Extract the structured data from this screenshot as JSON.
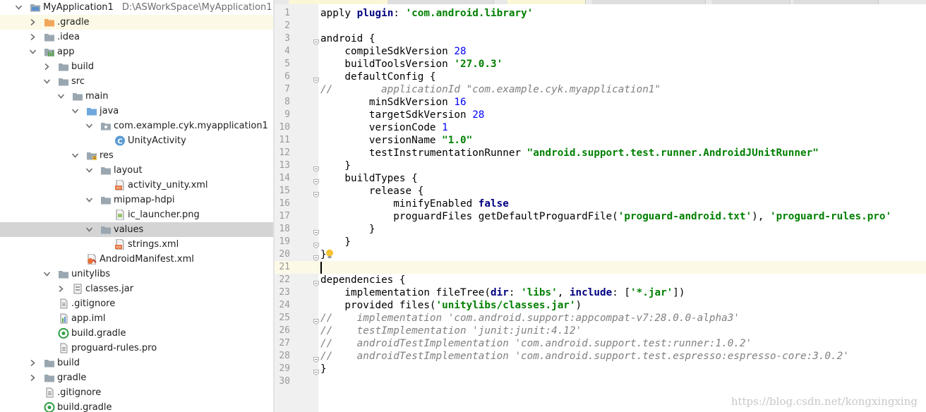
{
  "project_tree": {
    "rows": [
      {
        "label": "MyApplication1",
        "path": "D:\\ASWorkSpace\\MyApplication1",
        "icon": "module-icon",
        "arrow": "down",
        "indent": 0
      },
      {
        "label": ".gradle",
        "icon": "folder-orange-icon",
        "arrow": "right",
        "indent": 1,
        "highlight": true
      },
      {
        "label": ".idea",
        "icon": "folder-icon",
        "arrow": "right",
        "indent": 1
      },
      {
        "label": "app",
        "icon": "android-module-icon",
        "arrow": "down",
        "indent": 1
      },
      {
        "label": "build",
        "icon": "folder-icon",
        "arrow": "right",
        "indent": 2
      },
      {
        "label": "src",
        "icon": "folder-icon",
        "arrow": "down",
        "indent": 2
      },
      {
        "label": "main",
        "icon": "folder-icon",
        "arrow": "down",
        "indent": 3
      },
      {
        "label": "java",
        "icon": "folder-blue-icon",
        "arrow": "down",
        "indent": 4
      },
      {
        "label": "com.example.cyk.myapplication1",
        "icon": "package-icon",
        "arrow": "down",
        "indent": 5
      },
      {
        "label": "UnityActivity",
        "icon": "class-icon",
        "arrow": "none",
        "indent": 6
      },
      {
        "label": "res",
        "icon": "folder-res-icon",
        "arrow": "down",
        "indent": 4
      },
      {
        "label": "layout",
        "icon": "folder-icon",
        "arrow": "down",
        "indent": 5
      },
      {
        "label": "activity_unity.xml",
        "icon": "xml-file-icon",
        "arrow": "none",
        "indent": 6
      },
      {
        "label": "mipmap-hdpi",
        "icon": "folder-icon",
        "arrow": "down",
        "indent": 5
      },
      {
        "label": "ic_launcher.png",
        "icon": "image-file-icon",
        "arrow": "none",
        "indent": 6
      },
      {
        "label": "values",
        "icon": "folder-icon",
        "arrow": "down",
        "indent": 5,
        "selected": true
      },
      {
        "label": "strings.xml",
        "icon": "xml-file-icon",
        "arrow": "none",
        "indent": 6
      },
      {
        "label": "AndroidManifest.xml",
        "icon": "manifest-file-icon",
        "arrow": "none",
        "indent": 4
      },
      {
        "label": "unitylibs",
        "icon": "folder-icon",
        "arrow": "down",
        "indent": 2
      },
      {
        "label": "classes.jar",
        "icon": "jar-icon",
        "arrow": "right",
        "indent": 3
      },
      {
        "label": ".gitignore",
        "icon": "text-file-icon",
        "arrow": "none",
        "indent": 2
      },
      {
        "label": "app.iml",
        "icon": "iml-file-icon",
        "arrow": "none",
        "indent": 2
      },
      {
        "label": "build.gradle",
        "icon": "gradle-file-icon",
        "arrow": "none",
        "indent": 2
      },
      {
        "label": "proguard-rules.pro",
        "icon": "text-file-icon",
        "arrow": "none",
        "indent": 2
      },
      {
        "label": "build",
        "icon": "folder-icon",
        "arrow": "right",
        "indent": 1
      },
      {
        "label": "gradle",
        "icon": "folder-icon",
        "arrow": "right",
        "indent": 1
      },
      {
        "label": ".gitignore",
        "icon": "text-file-icon",
        "arrow": "none",
        "indent": 1
      },
      {
        "label": "build.gradle",
        "icon": "gradle-file-icon",
        "arrow": "none",
        "indent": 1
      }
    ]
  },
  "editor": {
    "lines": [
      {
        "n": "1",
        "fold": false,
        "tokens": [
          [
            "apply ",
            ""
          ],
          [
            "plugin",
            "kw"
          ],
          [
            ": ",
            ""
          ],
          [
            "'com.android.library'",
            "str"
          ]
        ]
      },
      {
        "n": "2",
        "fold": false,
        "tokens": []
      },
      {
        "n": "3",
        "fold": true,
        "tokens": [
          [
            "android {",
            ""
          ]
        ]
      },
      {
        "n": "4",
        "fold": false,
        "tokens": [
          [
            "    compileSdkVersion ",
            ""
          ],
          [
            "28",
            "num"
          ]
        ]
      },
      {
        "n": "5",
        "fold": false,
        "tokens": [
          [
            "    buildToolsVersion ",
            ""
          ],
          [
            "'27.0.3'",
            "str"
          ]
        ]
      },
      {
        "n": "6",
        "fold": true,
        "tokens": [
          [
            "    defaultConfig {",
            ""
          ]
        ]
      },
      {
        "n": "7",
        "fold": false,
        "tokens": [
          [
            "//        applicationId \"com.example.cyk.myapplication1\"",
            "cm"
          ]
        ]
      },
      {
        "n": "8",
        "fold": false,
        "tokens": [
          [
            "        minSdkVersion ",
            ""
          ],
          [
            "16",
            "num"
          ]
        ]
      },
      {
        "n": "9",
        "fold": false,
        "tokens": [
          [
            "        targetSdkVersion ",
            ""
          ],
          [
            "28",
            "num"
          ]
        ]
      },
      {
        "n": "10",
        "fold": false,
        "tokens": [
          [
            "        versionCode ",
            ""
          ],
          [
            "1",
            "num"
          ]
        ]
      },
      {
        "n": "11",
        "fold": false,
        "tokens": [
          [
            "        versionName ",
            ""
          ],
          [
            "\"1.0\"",
            "str"
          ]
        ]
      },
      {
        "n": "12",
        "fold": false,
        "tokens": [
          [
            "        testInstrumentationRunner ",
            ""
          ],
          [
            "\"android.support.test.runner.AndroidJUnitRunner\"",
            "str"
          ]
        ]
      },
      {
        "n": "13",
        "fold": true,
        "tokens": [
          [
            "    }",
            ""
          ]
        ]
      },
      {
        "n": "14",
        "fold": true,
        "tokens": [
          [
            "    buildTypes {",
            ""
          ]
        ]
      },
      {
        "n": "15",
        "fold": true,
        "tokens": [
          [
            "        release {",
            ""
          ]
        ]
      },
      {
        "n": "16",
        "fold": false,
        "tokens": [
          [
            "            minifyEnabled ",
            ""
          ],
          [
            "false",
            "kw"
          ]
        ]
      },
      {
        "n": "17",
        "fold": false,
        "tokens": [
          [
            "            proguardFiles getDefaultProguardFile(",
            ""
          ],
          [
            "'proguard-android.txt'",
            "str"
          ],
          [
            "), ",
            ""
          ],
          [
            "'proguard-rules.pro'",
            "str"
          ]
        ]
      },
      {
        "n": "18",
        "fold": true,
        "tokens": [
          [
            "        }",
            ""
          ]
        ]
      },
      {
        "n": "19",
        "fold": true,
        "tokens": [
          [
            "    }",
            ""
          ]
        ]
      },
      {
        "n": "20",
        "fold": true,
        "bulb": true,
        "tokens": [
          [
            "}",
            ""
          ]
        ]
      },
      {
        "n": "21",
        "fold": false,
        "caret": true,
        "tokens": []
      },
      {
        "n": "22",
        "fold": true,
        "tokens": [
          [
            "dependencies {",
            ""
          ]
        ]
      },
      {
        "n": "23",
        "fold": false,
        "tokens": [
          [
            "    implementation fileTree(",
            ""
          ],
          [
            "dir",
            "kw"
          ],
          [
            ": ",
            ""
          ],
          [
            "'libs'",
            "str"
          ],
          [
            ", ",
            ""
          ],
          [
            "include",
            "kw"
          ],
          [
            ": [",
            ""
          ],
          [
            "'*.jar'",
            "str"
          ],
          [
            "])",
            ""
          ]
        ]
      },
      {
        "n": "24",
        "fold": false,
        "tokens": [
          [
            "    provided files(",
            ""
          ],
          [
            "'unitylibs/classes.jar'",
            "str"
          ],
          [
            ")",
            ""
          ]
        ]
      },
      {
        "n": "25",
        "fold": true,
        "tokens": [
          [
            "//    implementation 'com.android.support:appcompat-v7:28.0.0-alpha3'",
            "cm"
          ]
        ]
      },
      {
        "n": "26",
        "fold": false,
        "tokens": [
          [
            "//    testImplementation 'junit:junit:4.12'",
            "cm"
          ]
        ]
      },
      {
        "n": "27",
        "fold": false,
        "tokens": [
          [
            "//    androidTestImplementation 'com.android.support.test:runner:1.0.2'",
            "cm"
          ]
        ]
      },
      {
        "n": "28",
        "fold": true,
        "tokens": [
          [
            "//    androidTestImplementation 'com.android.support.test.espresso:espresso-core:3.0.2'",
            "cm"
          ]
        ]
      },
      {
        "n": "29",
        "fold": true,
        "tokens": [
          [
            "}",
            ""
          ]
        ]
      },
      {
        "n": "30",
        "fold": false,
        "tokens": []
      }
    ]
  },
  "watermark": "https://blog.csdn.net/kongxingxing",
  "colors": {
    "keyword": "#000080",
    "string": "#008000",
    "number": "#0000ff",
    "comment": "#808080",
    "caret_line": "#fcfae6",
    "selection": "#d4d4d4"
  }
}
